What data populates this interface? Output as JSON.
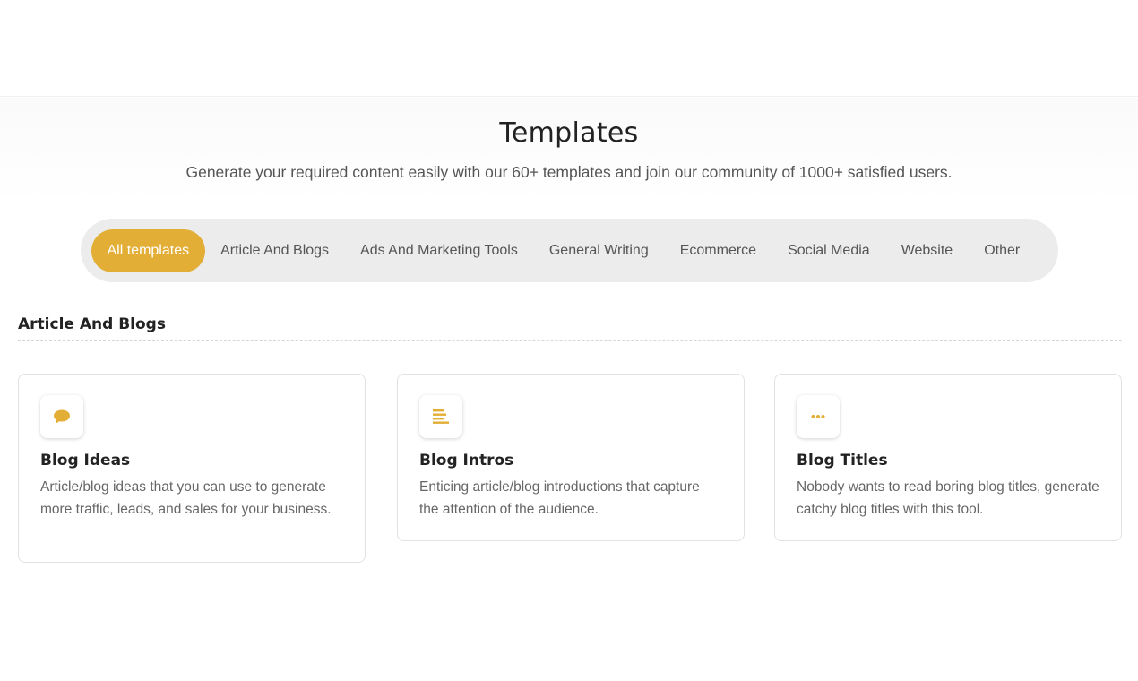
{
  "header": {
    "title": "Templates",
    "subtitle": "Generate your required content easily with our 60+ templates and join our community of 1000+ satisfied users."
  },
  "tabs": [
    {
      "label": "All templates",
      "active": true
    },
    {
      "label": "Article And Blogs",
      "active": false
    },
    {
      "label": "Ads And Marketing Tools",
      "active": false
    },
    {
      "label": "General Writing",
      "active": false
    },
    {
      "label": "Ecommerce",
      "active": false
    },
    {
      "label": "Social Media",
      "active": false
    },
    {
      "label": "Website",
      "active": false
    },
    {
      "label": "Other",
      "active": false
    }
  ],
  "section": {
    "title": "Article And Blogs"
  },
  "cards": [
    {
      "icon": "chat-bubble-icon",
      "title": "Blog Ideas",
      "description": "Article/blog ideas that you can use to generate more traffic, leads, and sales for your business."
    },
    {
      "icon": "text-lines-icon",
      "title": "Blog Intros",
      "description": "Enticing article/blog introductions that capture the attention of the audience."
    },
    {
      "icon": "ellipsis-icon",
      "title": "Blog Titles",
      "description": "Nobody wants to read boring blog titles, generate catchy blog titles with this tool."
    }
  ],
  "colors": {
    "accent": "#e3ae36",
    "tab_bar_bg": "#ececec",
    "text_muted": "#666666"
  }
}
